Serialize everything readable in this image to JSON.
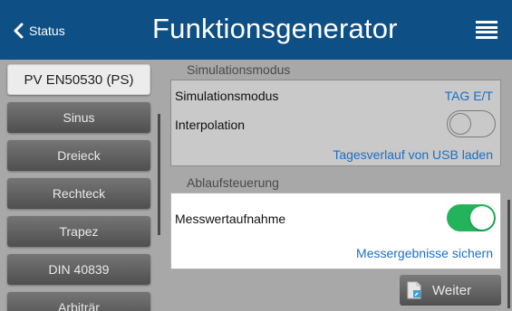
{
  "header": {
    "back_label": "Status",
    "title": "Funktionsgenerator",
    "color": "#0e4f86"
  },
  "sidebar": {
    "items": [
      {
        "label": "PV EN50530 (PS)",
        "active": true
      },
      {
        "label": "Sinus"
      },
      {
        "label": "Dreieck"
      },
      {
        "label": "Rechteck"
      },
      {
        "label": "Trapez"
      },
      {
        "label": "DIN 40839"
      },
      {
        "label": "Arbiträr"
      }
    ]
  },
  "simulation": {
    "section_label": "Simulationsmodus",
    "mode_label": "Simulationsmodus",
    "mode_value": "TAG E/T",
    "interpolation_label": "Interpolation",
    "interpolation_on": false,
    "load_link": "Tagesverlauf von USB laden"
  },
  "sequence": {
    "section_label": "Ablaufsteuerung",
    "recording_label": "Messwertaufnahme",
    "recording_on": true,
    "save_link": "Messergebnisse sichern"
  },
  "footer": {
    "next_label": "Weiter"
  },
  "colors": {
    "accent": "#1a6fc4",
    "toggle_on": "#22b35b"
  }
}
